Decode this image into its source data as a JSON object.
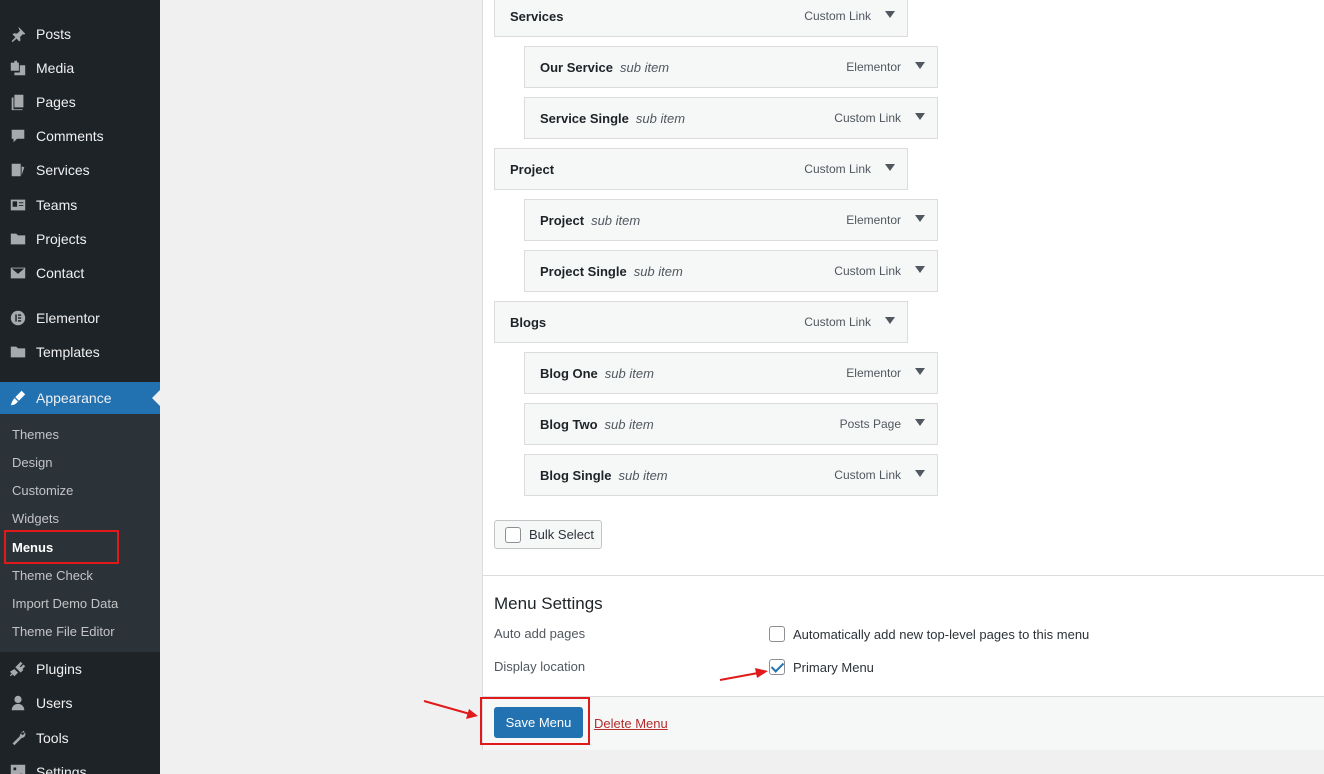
{
  "sidebar": {
    "items": [
      {
        "label": "Posts",
        "icon": "pin-icon"
      },
      {
        "label": "Media",
        "icon": "media-icon"
      },
      {
        "label": "Pages",
        "icon": "pages-icon"
      },
      {
        "label": "Comments",
        "icon": "comment-icon"
      },
      {
        "label": "Services",
        "icon": "services-icon"
      },
      {
        "label": "Teams",
        "icon": "teams-icon"
      },
      {
        "label": "Projects",
        "icon": "folder-icon"
      },
      {
        "label": "Contact",
        "icon": "mail-icon"
      },
      {
        "label": "Elementor",
        "icon": "elementor-icon"
      },
      {
        "label": "Templates",
        "icon": "folder-icon"
      },
      {
        "label": "Appearance",
        "icon": "brush-icon"
      },
      {
        "label": "Plugins",
        "icon": "plug-icon"
      },
      {
        "label": "Users",
        "icon": "user-icon"
      },
      {
        "label": "Tools",
        "icon": "wrench-icon"
      },
      {
        "label": "Settings",
        "icon": "settings-icon"
      }
    ],
    "submenu": [
      "Themes",
      "Design",
      "Customize",
      "Widgets",
      "Menus",
      "Theme Check",
      "Import Demo Data",
      "Theme File Editor"
    ],
    "current_submenu": "Menus"
  },
  "menu_items": [
    {
      "title": "Services",
      "sub": "",
      "type": "Custom Link"
    },
    {
      "title": "Our Service",
      "sub": "sub item",
      "type": "Elementor"
    },
    {
      "title": "Service Single",
      "sub": "sub item",
      "type": "Custom Link"
    },
    {
      "title": "Project",
      "sub": "",
      "type": "Custom Link"
    },
    {
      "title": "Project",
      "sub": "sub item",
      "type": "Elementor"
    },
    {
      "title": "Project Single",
      "sub": "sub item",
      "type": "Custom Link"
    },
    {
      "title": "Blogs",
      "sub": "",
      "type": "Custom Link"
    },
    {
      "title": "Blog One",
      "sub": "sub item",
      "type": "Elementor"
    },
    {
      "title": "Blog Two",
      "sub": "sub item",
      "type": "Posts Page"
    },
    {
      "title": "Blog Single",
      "sub": "sub item",
      "type": "Custom Link"
    }
  ],
  "bulk_select": "Bulk Select",
  "settings": {
    "title": "Menu Settings",
    "auto_add_label": "Auto add pages",
    "auto_add_option": "Automatically add new top-level pages to this menu",
    "display_label": "Display location",
    "primary_menu": "Primary Menu"
  },
  "actions": {
    "save": "Save Menu",
    "delete": "Delete Menu"
  },
  "colors": {
    "accent": "#2271b1",
    "sidebar_bg": "#1d2327",
    "annotation": "#e01a1a"
  }
}
